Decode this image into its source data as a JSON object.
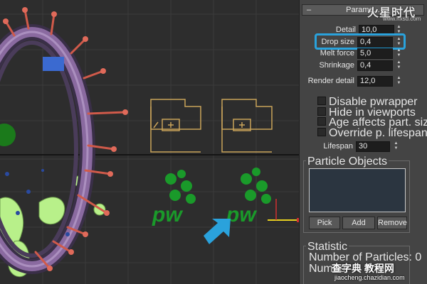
{
  "rollout": {
    "collapse_symbol": "–",
    "title": "Parame..."
  },
  "watermarks": {
    "top_text": "火星时代",
    "top_url": "www.hxsd.com",
    "bottom_text": "查字典 教程网",
    "bottom_url": "jiaocheng.chazidian.com"
  },
  "params": {
    "detail": {
      "label": "Detail",
      "value": "10,0"
    },
    "drop_size": {
      "label": "Drop size",
      "value": "0,4"
    },
    "melt_force": {
      "label": "Melt force",
      "value": "5,0"
    },
    "shrinkage": {
      "label": "Shrinkage",
      "value": "0,4"
    },
    "render_detail": {
      "label": "Render detail",
      "value": "12,0"
    },
    "lifespan": {
      "label": "Lifespan",
      "value": "30"
    }
  },
  "checkboxes": [
    {
      "label": "Disable pwrapper",
      "checked": false
    },
    {
      "label": "Hide in viewports",
      "checked": false
    },
    {
      "label": "Age affects part. size",
      "checked": false
    },
    {
      "label": "Override p. lifespan",
      "checked": false
    }
  ],
  "particle_objects": {
    "title": "Particle Objects",
    "buttons": {
      "pick": "Pick",
      "add": "Add",
      "remove": "Remove"
    }
  },
  "statistic": {
    "title": "Statistic",
    "number_of_particles": "Number of Particles: 0",
    "number_partial": "Number"
  },
  "viewport": {
    "helper_text": "pw",
    "accent_colors": {
      "helper_green": "#1a9a2a",
      "wrapper_outline": "#c9a35a",
      "callout_arrow": "#2aa2dc",
      "torus_purple": "#8a6aa0"
    }
  },
  "spinner_icon": "spinner-arrows-icon"
}
